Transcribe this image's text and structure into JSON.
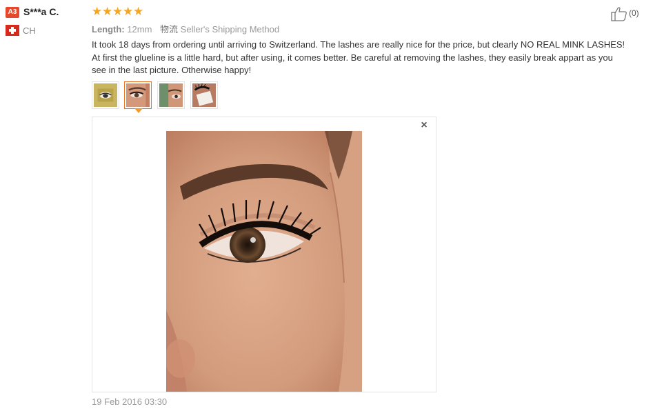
{
  "user": {
    "level_badge": "A3",
    "name": "S***a C.",
    "country": "CH",
    "flag_icon": "swiss-flag-icon"
  },
  "review": {
    "rating": 5,
    "stars_text": "★★★★★",
    "length_label": "Length:",
    "length_value": "12mm",
    "shipping_cn": "物流",
    "shipping_method": "Seller's Shipping Method",
    "text": "It took 18 days from ordering until arriving to Switzerland. The lashes are really nice for the price, but clearly NO REAL MINK LASHES! At first the glueline is a little hard, but after using, it comes better. Be careful at removing the lashes, they easily break appart as you see in the last picture. Otherwise happy!",
    "date": "19 Feb 2016 03:30"
  },
  "helpful": {
    "icon": "thumbs-up-icon",
    "count": "(0)"
  },
  "gallery": {
    "selected_index": 1,
    "close_label": "×",
    "thumbnails": [
      {
        "name": "thumbnail-lash-package"
      },
      {
        "name": "thumbnail-eye-closeup"
      },
      {
        "name": "thumbnail-eye-side"
      },
      {
        "name": "thumbnail-lash-strip"
      }
    ]
  },
  "colors": {
    "star": "#f5a623",
    "badge": "#e5492d",
    "active_border": "#e8741f",
    "flag_red": "#d52b1e"
  }
}
